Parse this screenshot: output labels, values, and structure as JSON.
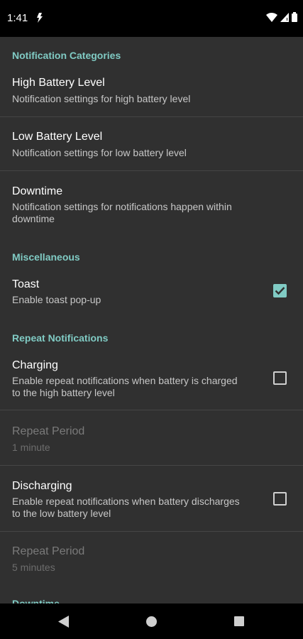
{
  "status_bar": {
    "time": "1:41",
    "icons": [
      "app-notification-icon",
      "wifi-icon",
      "cell-signal-icon",
      "battery-icon"
    ]
  },
  "sections": {
    "notification_categories": {
      "header": "Notification Categories",
      "high_battery": {
        "title": "High Battery Level",
        "summary": "Notification settings for high battery level"
      },
      "low_battery": {
        "title": "Low Battery Level",
        "summary": "Notification settings for low battery level"
      },
      "downtime": {
        "title": "Downtime",
        "summary_line1": "Notification settings for notifications happen within",
        "summary_line2": "downtime"
      }
    },
    "miscellaneous": {
      "header": "Miscellaneous",
      "toast": {
        "title": "Toast",
        "summary": "Enable toast pop-up",
        "checked": true
      }
    },
    "repeat_notifications": {
      "header": "Repeat Notifications",
      "charging": {
        "title": "Charging",
        "summary_line1": "Enable repeat notifications when battery is charged",
        "summary_line2": "to the high battery level",
        "checked": false
      },
      "charging_period": {
        "title": "Repeat Period",
        "summary": "1 minute",
        "enabled": false
      },
      "discharging": {
        "title": "Discharging",
        "summary_line1": "Enable repeat notifications when battery discharges",
        "summary_line2": "to the low battery level",
        "checked": false
      },
      "discharging_period": {
        "title": "Repeat Period",
        "summary": "5 minutes",
        "enabled": false
      }
    },
    "downtime_partial": {
      "header": "Downtime"
    }
  },
  "colors": {
    "accent": "#80cbc4",
    "background": "#303030",
    "bars": "#000000"
  },
  "nav_bar": {
    "icons": [
      "back-icon",
      "home-icon",
      "recents-icon"
    ]
  }
}
